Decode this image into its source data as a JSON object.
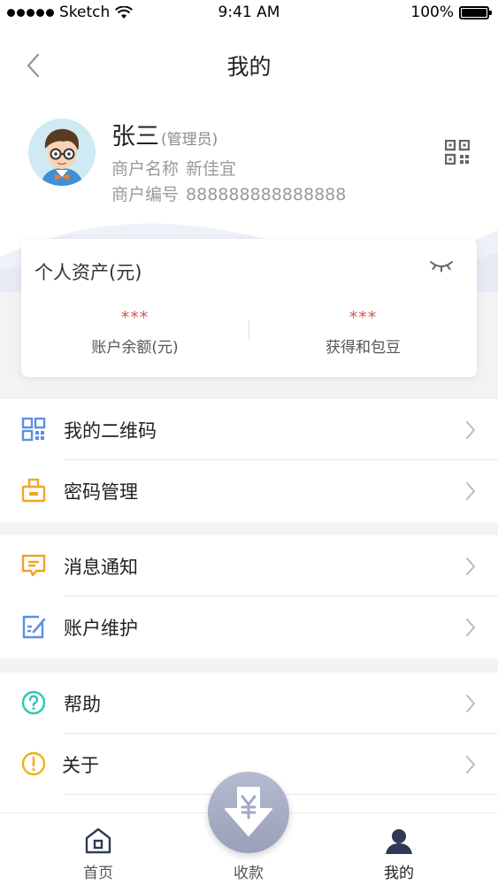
{
  "status_bar": {
    "carrier": "Sketch",
    "time": "9:41 AM",
    "battery": "100%"
  },
  "nav": {
    "title": "我的"
  },
  "profile": {
    "name": "张三",
    "role": "(管理员)",
    "merchant_name_label": "商户名称",
    "merchant_name": "新佳宜",
    "merchant_id_label": "商户编号",
    "merchant_id": "888888888888888"
  },
  "assets": {
    "title": "个人资产(元)",
    "balance_value": "***",
    "balance_label": "账户余额(元)",
    "beans_value": "***",
    "beans_label": "获得和包豆"
  },
  "menu": {
    "group1": [
      {
        "label": "我的二维码",
        "icon": "qrcode-icon"
      },
      {
        "label": "密码管理",
        "icon": "lock-icon"
      }
    ],
    "group2": [
      {
        "label": "消息通知",
        "icon": "message-icon"
      },
      {
        "label": "账户维护",
        "icon": "edit-icon"
      }
    ],
    "group3": [
      {
        "label": "帮助",
        "icon": "help-icon"
      },
      {
        "label": "关于",
        "icon": "info-icon"
      }
    ]
  },
  "tabs": [
    {
      "label": "首页",
      "icon": "home-icon"
    },
    {
      "label": "收款",
      "icon": "receive-money-icon"
    },
    {
      "label": "我的",
      "icon": "user-icon",
      "active": true
    }
  ],
  "colors": {
    "qr_blue": "#5b8fe6",
    "lock_orange": "#f2a623",
    "message_orange": "#f0a12a",
    "edit_blue": "#5b8fe6",
    "help_teal": "#2cc7b2",
    "info_yellow": "#f2b01c",
    "asset_red": "#d9534f",
    "tab_dark": "#2e3a55",
    "fab_gray": "#a3a9c2"
  }
}
